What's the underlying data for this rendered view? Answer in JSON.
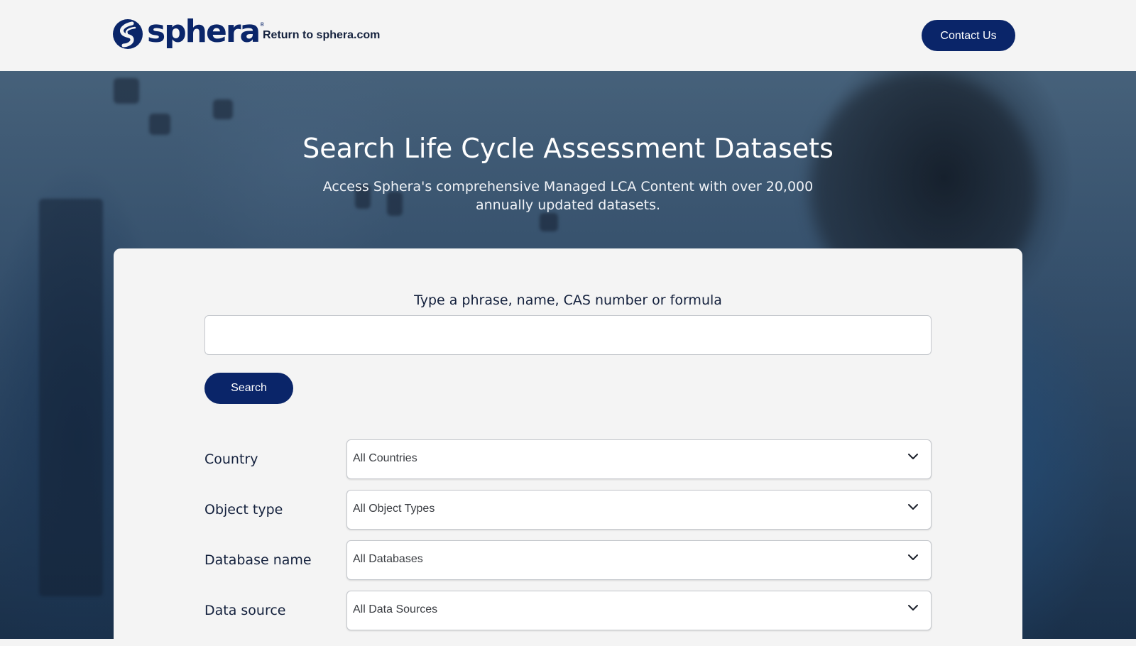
{
  "header": {
    "logo_text": "sphera",
    "logo_registered": "®",
    "return_link": "Return to sphera.com",
    "contact_button": "Contact Us"
  },
  "hero": {
    "title": "Search Life Cycle Assessment Datasets",
    "subtitle": "Access Sphera's comprehensive Managed LCA Content with over 20,000 annually updated datasets."
  },
  "search": {
    "label": "Type a phrase, name, CAS number or formula",
    "value": "",
    "button": "Search"
  },
  "filters": [
    {
      "label": "Country",
      "selected": "All Countries"
    },
    {
      "label": "Object type",
      "selected": "All Object Types"
    },
    {
      "label": "Database name",
      "selected": "All Databases"
    },
    {
      "label": "Data source",
      "selected": "All Data Sources"
    }
  ],
  "colors": {
    "brand_navy": "#0a2569",
    "page_bg": "#f4f4f4",
    "text_dark": "#14213d"
  }
}
